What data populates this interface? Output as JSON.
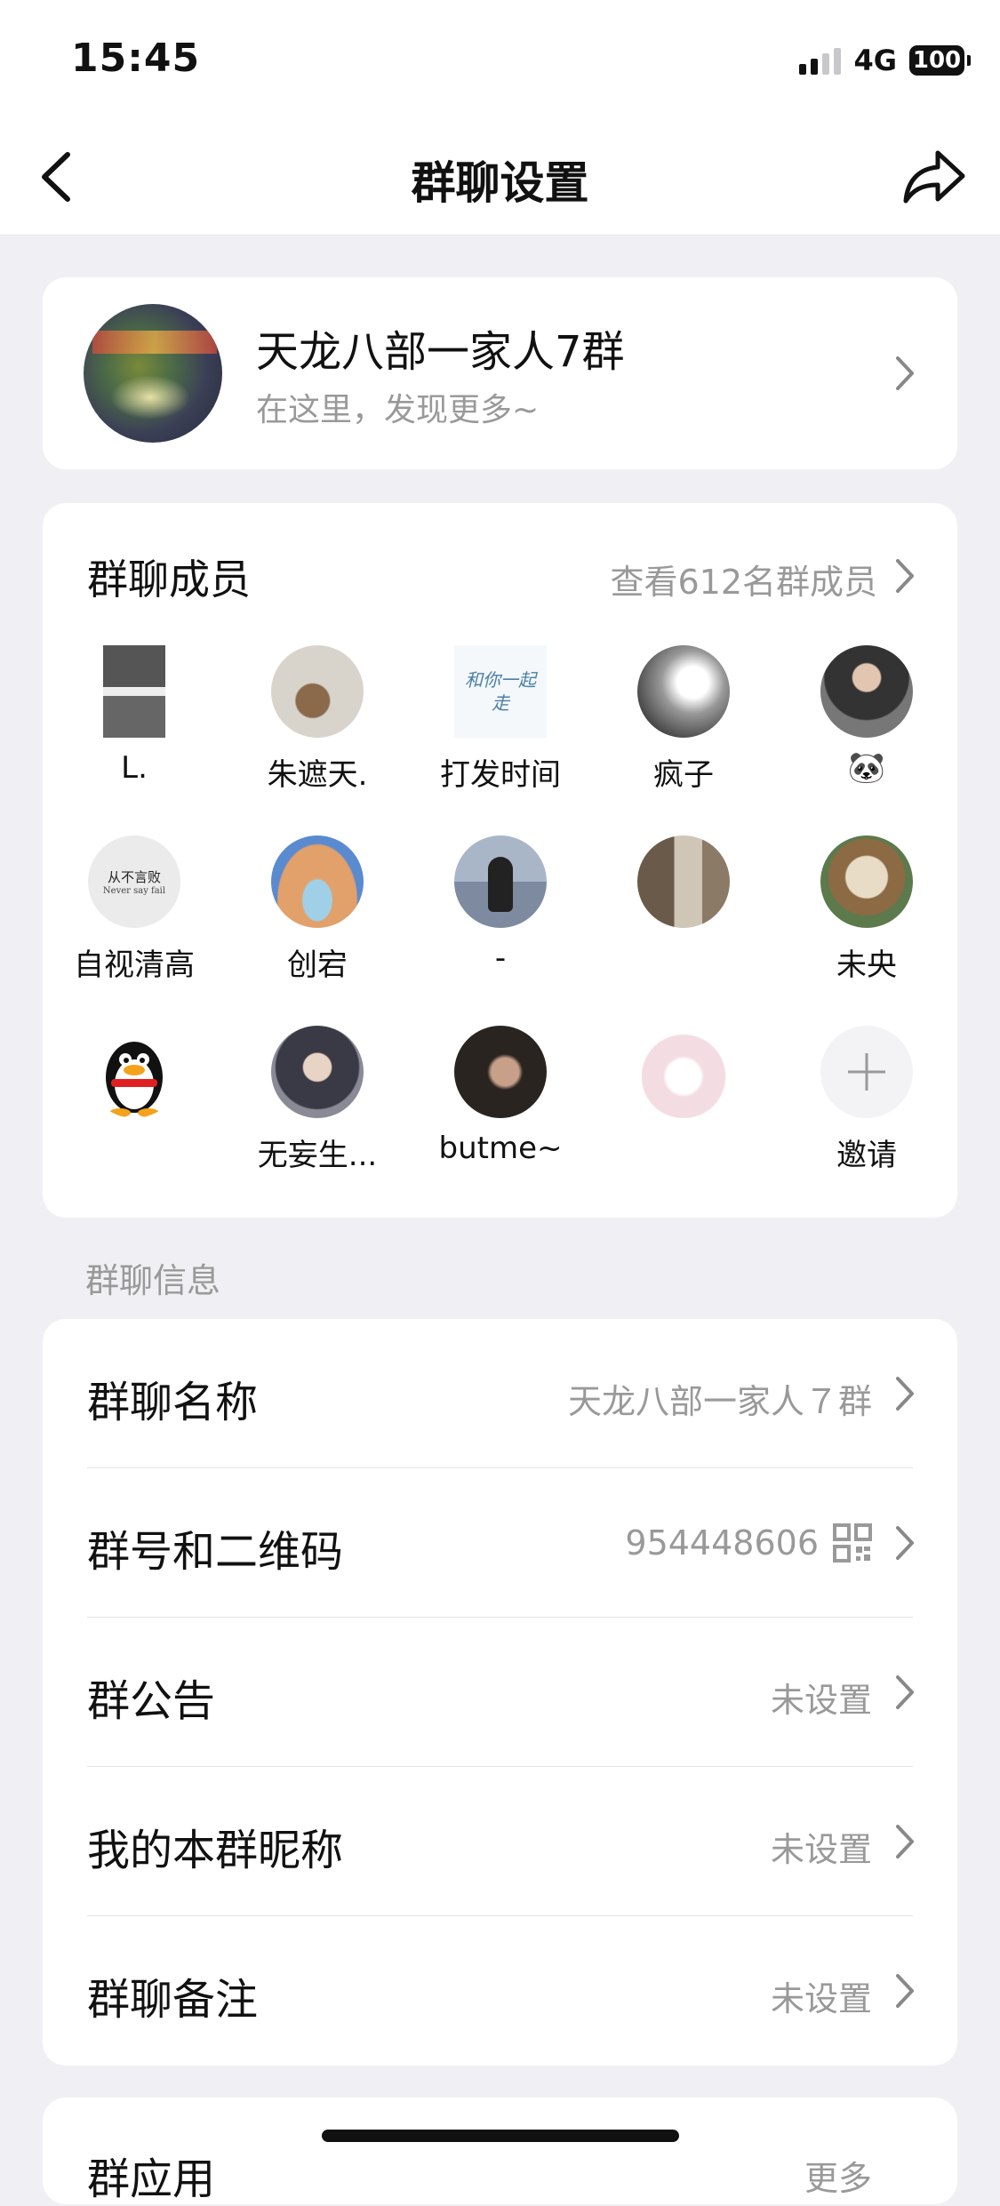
{
  "status": {
    "time": "15:45",
    "network": "4G",
    "battery": "100"
  },
  "nav": {
    "title": "群聊设置"
  },
  "group": {
    "name": "天龙八部一家人7群",
    "subtitle": "在这里，发现更多~"
  },
  "members": {
    "title": "群聊成员",
    "view_all": "查看612名群成员",
    "items": [
      {
        "name": "L.",
        "avatar": "photo-grid"
      },
      {
        "name": "朱遮天.",
        "avatar": "hand-photo"
      },
      {
        "name": "打发时间",
        "avatar": "text-art"
      },
      {
        "name": "疯子",
        "avatar": "treble-clef"
      },
      {
        "name": "🐼",
        "avatar": "man-sunglasses"
      },
      {
        "name": "自视清高",
        "avatar": "text-never-say-fail"
      },
      {
        "name": "创宕",
        "avatar": "shiba-mask"
      },
      {
        "name": "-",
        "avatar": "girl-back"
      },
      {
        "name": "",
        "avatar": "shop-photo"
      },
      {
        "name": "未央",
        "avatar": "dog"
      },
      {
        "name": "",
        "avatar": "qq-penguin"
      },
      {
        "name": "无妄生...",
        "avatar": "anime-boy"
      },
      {
        "name": "butme~",
        "avatar": "man-dark"
      },
      {
        "name": "",
        "avatar": "anime-girl"
      },
      {
        "name": "邀请",
        "avatar": "plus-icon"
      }
    ],
    "avatar_text": {
      "text_art": "和你一起走",
      "never_top": "从不言败",
      "never_bottom": "Never say fail"
    }
  },
  "info": {
    "section_label": "群聊信息",
    "rows": [
      {
        "label": "群聊名称",
        "value": "天龙八部一家人７群"
      },
      {
        "label": "群号和二维码",
        "value": "954448606"
      },
      {
        "label": "群公告",
        "value": "未设置"
      },
      {
        "label": "我的本群昵称",
        "value": "未设置"
      },
      {
        "label": "群聊备注",
        "value": "未设置"
      }
    ]
  },
  "apps": {
    "label": "群应用",
    "more": "更多"
  },
  "colors": {
    "background": "#f0f0f4",
    "card": "#ffffff",
    "secondary_text": "#999999"
  }
}
